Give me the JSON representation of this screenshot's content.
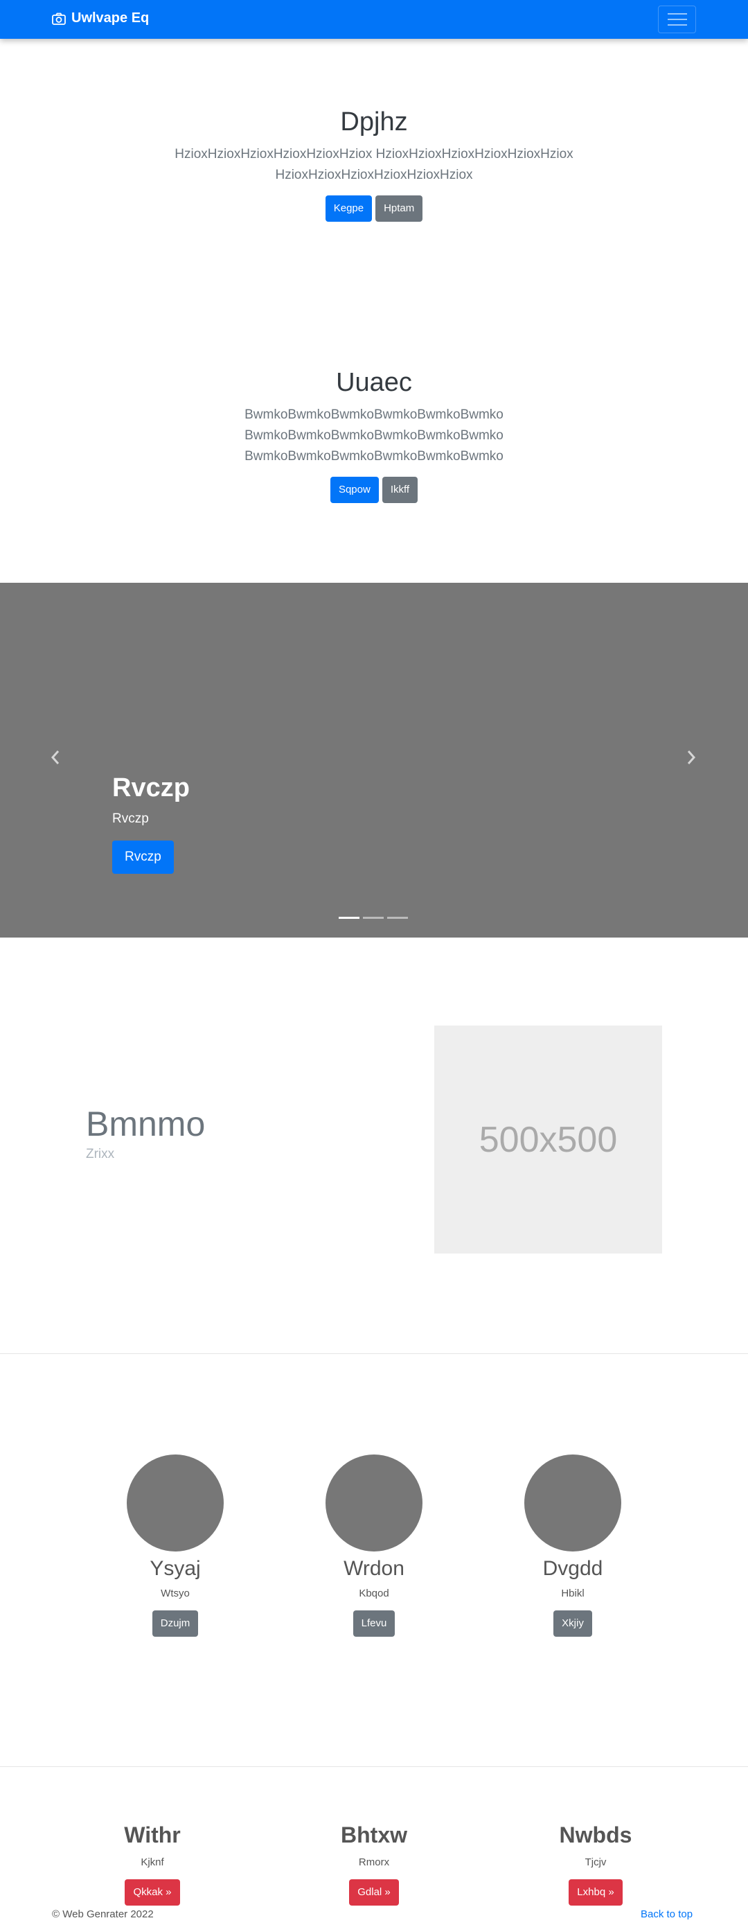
{
  "navbar": {
    "brand": "Uwlvape Eq"
  },
  "hero1": {
    "title": "Dpjhz",
    "text": "HzioxHzioxHzioxHzioxHzioxHziox HzioxHzioxHzioxHzioxHzioxHziox HzioxHzioxHzioxHzioxHzioxHziox",
    "primary": "Kegpe",
    "secondary": "Hptam"
  },
  "hero2": {
    "title": "Uuaec",
    "lines": [
      "BwmkoBwmkoBwmkoBwmkoBwmkoBwmko",
      "BwmkoBwmkoBwmkoBwmkoBwmkoBwmko",
      "BwmkoBwmkoBwmkoBwmkoBwmkoBwmko"
    ],
    "primary": "Sqpow",
    "secondary": "Ikkff"
  },
  "carousel": {
    "title": "Rvczp",
    "text": "Rvczp",
    "button": "Rvczp",
    "prev_icon": "chevron-left-icon",
    "next_icon": "chevron-right-icon"
  },
  "feature": {
    "title": "Bmnmo",
    "subtitle": "Zrixx",
    "placeholder": "500x500"
  },
  "team": [
    {
      "name": "Ysyaj",
      "role": "Wtsyo",
      "button": "Dzujm"
    },
    {
      "name": "Wrdon",
      "role": "Kbqod",
      "button": "Lfevu"
    },
    {
      "name": "Dvgdd",
      "role": "Hbikl",
      "button": "Xkjiy"
    }
  ],
  "features": [
    {
      "title": "Withr",
      "text": "Kjknf",
      "button": "Qkkak »"
    },
    {
      "title": "Bhtxw",
      "text": "Rmorx",
      "button": "Gdlal »"
    },
    {
      "title": "Nwbds",
      "text": "Tjcjv",
      "button": "Lxhbq »"
    }
  ],
  "footer": {
    "copyright": "© Web Genrater 2022",
    "back_to_top": "Back to top"
  },
  "colors": {
    "primary": "#0275f8",
    "secondary": "#6c757d",
    "danger": "#dc3545",
    "carousel_bg": "#777777"
  }
}
